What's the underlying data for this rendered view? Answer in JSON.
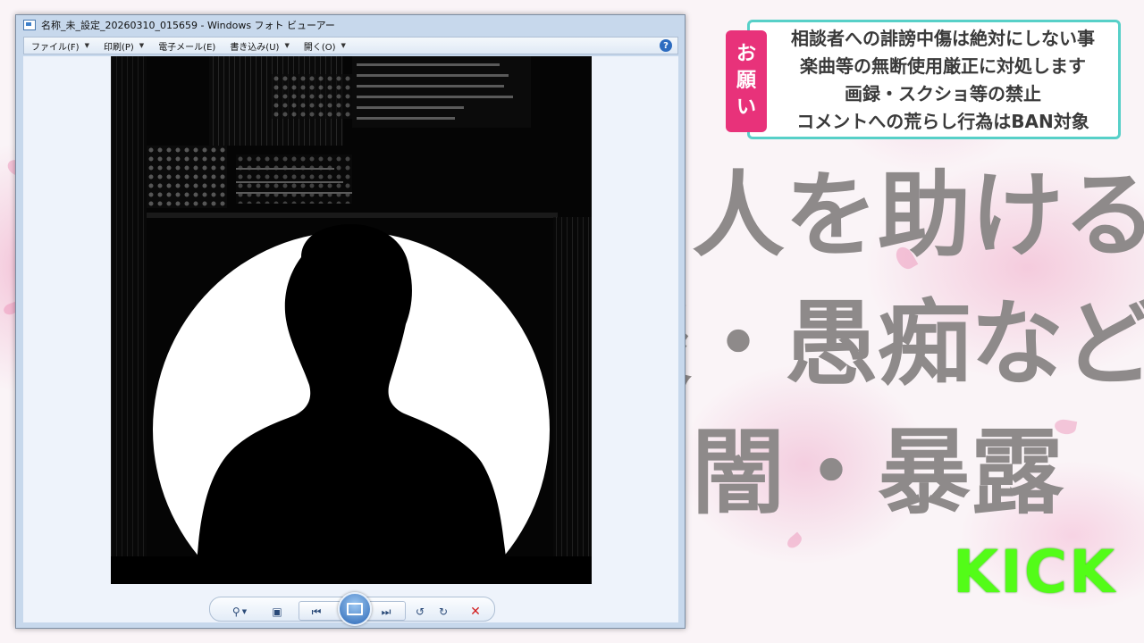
{
  "window": {
    "title": "名称_未_設定_20260310_015659 - Windows フォト ビューアー"
  },
  "menu": [
    {
      "label": "ファイル(F)"
    },
    {
      "label": "印刷(P)"
    },
    {
      "label": "電子メール(E)"
    },
    {
      "label": "書き込み(U)"
    },
    {
      "label": "開く(O)"
    }
  ],
  "icons": {
    "help": "help-icon",
    "zoom": "zoom-icon",
    "fit": "actual-size-icon",
    "prev": "previous-icon",
    "slideshow": "slideshow-icon",
    "next": "next-icon",
    "rotate_ccw": "rotate-counterclockwise-icon",
    "rotate_cw": "rotate-clockwise-icon",
    "delete": "delete-icon"
  },
  "notice": {
    "tag": [
      "お",
      "願",
      "い"
    ],
    "lines": [
      "相談者への誹謗中傷は絶対にしない事",
      "楽曲等の無断使用厳正に対処します",
      "画録・スクショ等の禁止",
      "コメントへの荒らし行為はBAN対象"
    ]
  },
  "headline": {
    "line1": "る人を助ける",
    "line2": "談・愚痴など",
    "line3": "の闇・暴露"
  },
  "brand": {
    "kick": "KICK"
  },
  "colors": {
    "notice_border": "#57d0c8",
    "notice_tag": "#e8327a",
    "kick_green": "#53fc18",
    "headline_gray": "#8e8a8a"
  }
}
